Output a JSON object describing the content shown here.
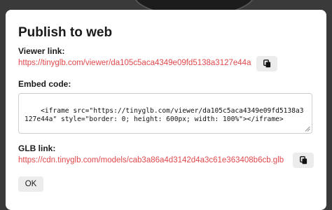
{
  "dialog": {
    "title": "Publish to web",
    "viewer": {
      "label": "Viewer link:",
      "url": "https://tinyglb.com/viewer/da105c5aca4349e09fd5138a3127e44a",
      "copy_icon": "copy-icon"
    },
    "embed": {
      "label": "Embed code:",
      "code": "<iframe src=\"https://tinyglb.com/viewer/da105c5aca4349e09fd5138a3127e44a\" style=\"border: 0; height: 600px; width: 100%\"></iframe>"
    },
    "glb": {
      "label": "GLB link:",
      "url": "https://cdn.tinyglb.com/models/cab3a86a4d3142d4a3c61e363408b6cb.glb",
      "copy_icon": "copy-icon"
    },
    "ok_label": "OK"
  },
  "colors": {
    "link": "#e0484c",
    "button_bg": "#ececec",
    "dialog_bg": "#ffffff",
    "backdrop": "#3a3a3a"
  }
}
